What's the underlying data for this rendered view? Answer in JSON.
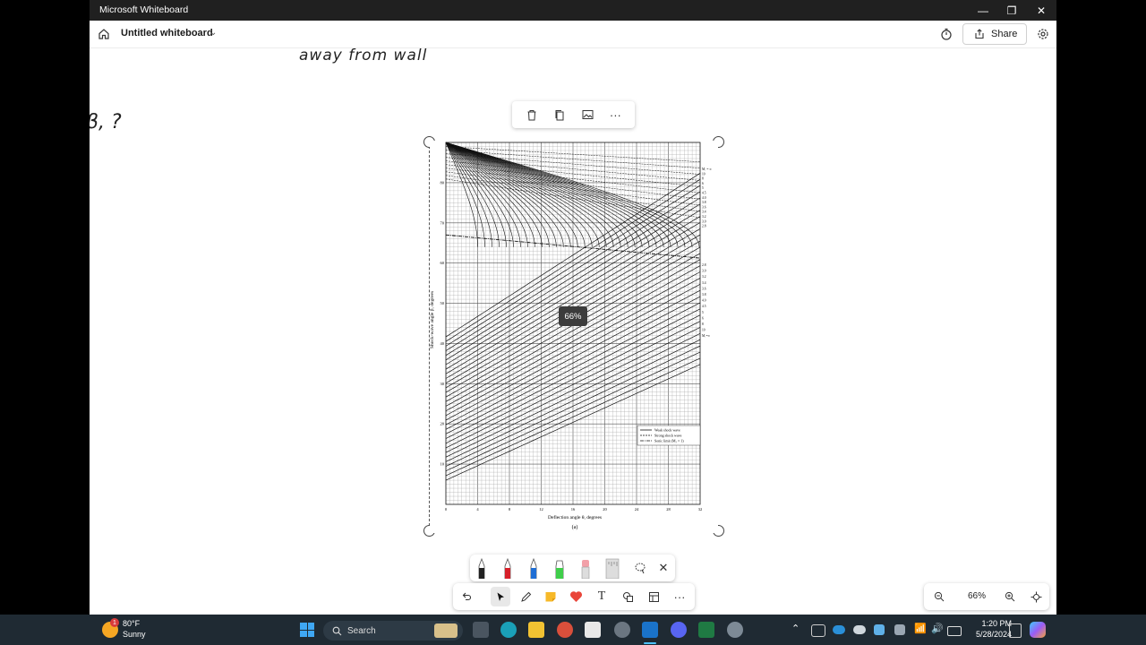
{
  "window": {
    "app_title": "Microsoft Whiteboard"
  },
  "header": {
    "doc_title": "Untitled whiteboard",
    "share_label": "Share"
  },
  "canvas": {
    "ink_text_1": "away from wall",
    "ink_text_2": "β, ?",
    "zoom_tooltip": "66%"
  },
  "chart_image": {
    "y_ticks": [
      "10",
      "20",
      "30",
      "40",
      "50",
      "60",
      "70",
      "80"
    ],
    "x_ticks": [
      "0",
      "4",
      "8",
      "12",
      "16",
      "20",
      "24",
      "28",
      "32"
    ],
    "x_label": "Deflection angle θ, degrees",
    "y_label": "Shock-wave angle β, degrees",
    "caption": "(a)",
    "legend": [
      "Weak shock wave",
      "Strong shock wave",
      "Sonic limit (M₂ = 1)"
    ],
    "right_labels_top": [
      "M₁ = ∞",
      "10",
      "8",
      "6",
      "5",
      "4.5",
      "4.0",
      "3.8",
      "3.6",
      "3.4",
      "3.2",
      "3.0",
      "2.8"
    ],
    "right_labels_bottom": [
      "2.8",
      "3.0",
      "3.2",
      "3.4",
      "3.6",
      "3.8",
      "4.0",
      "4.5",
      "5",
      "6",
      "8",
      "10",
      "M₁=∞"
    ]
  },
  "zoom": {
    "value": "66%"
  },
  "taskbar": {
    "weather_temp": "80°F",
    "weather_desc": "Sunny",
    "weather_badge": "1",
    "search_placeholder": "Search",
    "time": "1:20 PM",
    "date": "5/28/2024"
  },
  "colors": {
    "titlebar": "#202020",
    "taskbar": "#1f2a33",
    "accent": "#0078d4"
  }
}
